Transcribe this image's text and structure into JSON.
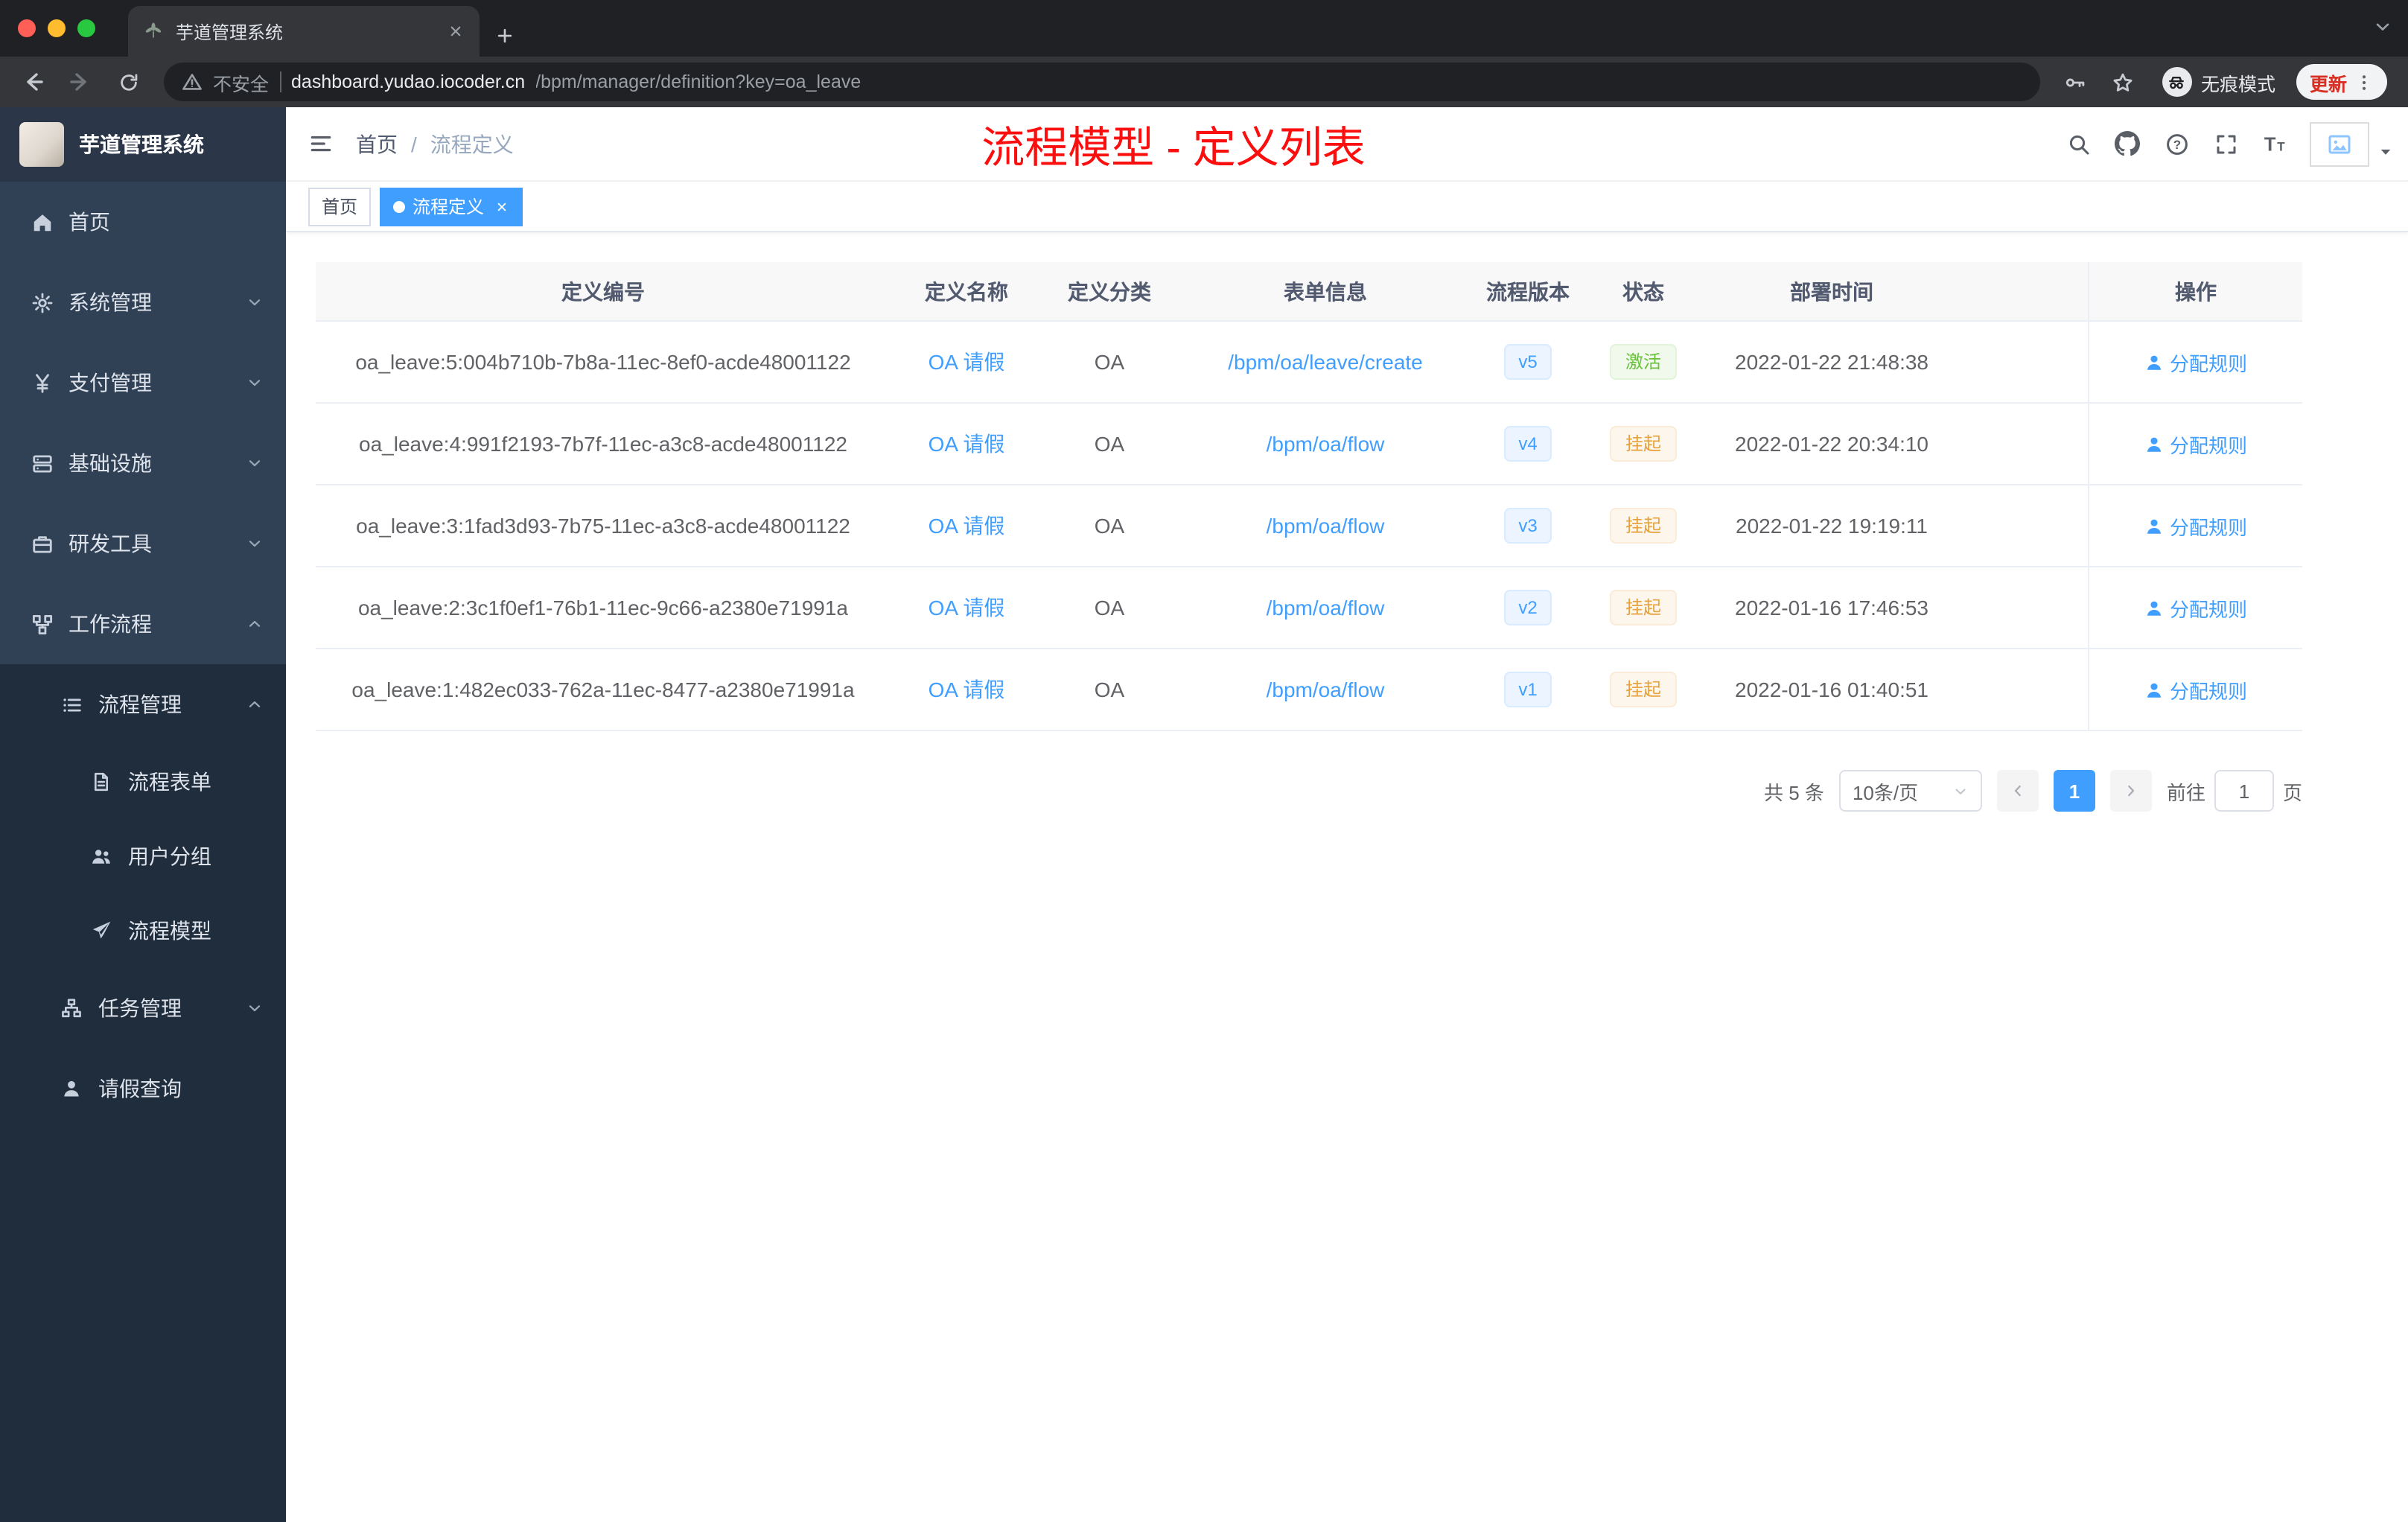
{
  "colors": {
    "accent_blue": "#409eff",
    "success_green": "#67c23a",
    "warning_orange": "#e6a23c",
    "annotation_red": "#fb0e0e",
    "sidebar_bg": "#304156",
    "sidebar_submenu_bg": "#1f2d3d"
  },
  "browser": {
    "tab_title": "芋道管理系统",
    "security_label": "不安全",
    "url_host": "dashboard.yudao.iocoder.cn",
    "url_path": "/bpm/manager/definition?key=oa_leave",
    "incognito_label": "无痕模式",
    "update_label": "更新"
  },
  "sidebar": {
    "logo_title": "芋道管理系统",
    "menu": [
      {
        "label": "首页",
        "icon": "home-icon"
      },
      {
        "label": "系统管理",
        "icon": "gear-icon",
        "chevron": "down"
      },
      {
        "label": "支付管理",
        "icon": "yen-icon",
        "chevron": "down"
      },
      {
        "label": "基础设施",
        "icon": "server-icon",
        "chevron": "down"
      },
      {
        "label": "研发工具",
        "icon": "toolbox-icon",
        "chevron": "down"
      },
      {
        "label": "工作流程",
        "icon": "workflow-icon",
        "chevron": "up"
      }
    ],
    "workflow_submenu": {
      "process_management": {
        "label": "流程管理",
        "icon": "list-icon",
        "chevron": "up"
      },
      "process_children": [
        {
          "label": "流程表单",
          "icon": "document-icon"
        },
        {
          "label": "用户分组",
          "icon": "user-group-icon"
        },
        {
          "label": "流程模型",
          "icon": "paper-plane-icon"
        }
      ],
      "task_management": {
        "label": "任务管理",
        "icon": "tree-icon",
        "chevron": "down"
      },
      "leave_query": {
        "label": "请假查询",
        "icon": "user-icon"
      }
    }
  },
  "header": {
    "breadcrumb_home": "首页",
    "breadcrumb_separator": "/",
    "breadcrumb_current": "流程定义",
    "annotation": "流程模型 - 定义列表",
    "tools": [
      "search-icon",
      "github-icon",
      "question-icon",
      "fullscreen-icon",
      "font-size-icon",
      "avatar",
      "caret-down-icon"
    ]
  },
  "tagsview": {
    "tags": [
      {
        "label": "首页",
        "active": false
      },
      {
        "label": "流程定义",
        "active": true
      }
    ]
  },
  "table": {
    "columns": [
      "定义编号",
      "定义名称",
      "定义分类",
      "表单信息",
      "流程版本",
      "状态",
      "部署时间",
      "操作"
    ],
    "rows": [
      {
        "id": "oa_leave:5:004b710b-7b8a-11ec-8ef0-acde48001122",
        "name": "OA 请假",
        "category": "OA",
        "form": "/bpm/oa/leave/create",
        "version": "v5",
        "status": "激活",
        "status_type": "success",
        "deployed_at": "2022-01-22 21:48:38",
        "action": "分配规则"
      },
      {
        "id": "oa_leave:4:991f2193-7b7f-11ec-a3c8-acde48001122",
        "name": "OA 请假",
        "category": "OA",
        "form": "/bpm/oa/flow",
        "version": "v4",
        "status": "挂起",
        "status_type": "warning",
        "deployed_at": "2022-01-22 20:34:10",
        "action": "分配规则"
      },
      {
        "id": "oa_leave:3:1fad3d93-7b75-11ec-a3c8-acde48001122",
        "name": "OA 请假",
        "category": "OA",
        "form": "/bpm/oa/flow",
        "version": "v3",
        "status": "挂起",
        "status_type": "warning",
        "deployed_at": "2022-01-22 19:19:11",
        "action": "分配规则"
      },
      {
        "id": "oa_leave:2:3c1f0ef1-76b1-11ec-9c66-a2380e71991a",
        "name": "OA 请假",
        "category": "OA",
        "form": "/bpm/oa/flow",
        "version": "v2",
        "status": "挂起",
        "status_type": "warning",
        "deployed_at": "2022-01-16 17:46:53",
        "action": "分配规则"
      },
      {
        "id": "oa_leave:1:482ec033-762a-11ec-8477-a2380e71991a",
        "name": "OA 请假",
        "category": "OA",
        "form": "/bpm/oa/flow",
        "version": "v1",
        "status": "挂起",
        "status_type": "warning",
        "deployed_at": "2022-01-16 01:40:51",
        "action": "分配规则"
      }
    ]
  },
  "pagination": {
    "total_label": "共 5 条",
    "page_size_label": "10条/页",
    "current_page": "1",
    "goto_label": "前往",
    "goto_value": "1",
    "page_unit_label": "页"
  }
}
